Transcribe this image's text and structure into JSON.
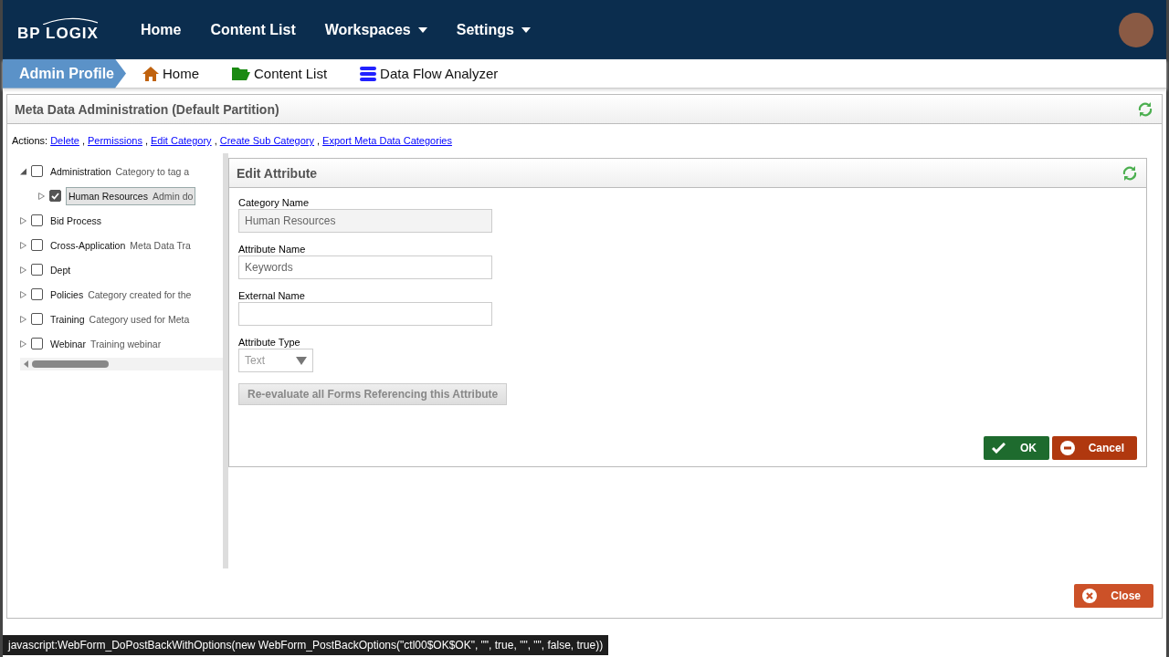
{
  "brand": {
    "logo_text": "BP LOGIX"
  },
  "nav": [
    {
      "label": "Home",
      "dropdown": false
    },
    {
      "label": "Content List",
      "dropdown": false
    },
    {
      "label": "Workspaces",
      "dropdown": true
    },
    {
      "label": "Settings",
      "dropdown": true
    }
  ],
  "breadcrumb": {
    "current": "Admin Profile",
    "links": [
      {
        "kind": "home",
        "label": "Home"
      },
      {
        "kind": "folder",
        "label": "Content List"
      },
      {
        "kind": "database",
        "label": "Data Flow Analyzer"
      }
    ]
  },
  "panel": {
    "title": "Meta Data Administration (Default Partition)",
    "actions_label": "Actions:",
    "actions_separator": ",",
    "actions": [
      "Delete",
      "Permissions",
      "Edit Category",
      "Create Sub Category",
      "Export Meta Data Categories"
    ],
    "tree": [
      {
        "name": "Administration",
        "description": "Category to tag a",
        "checked": false,
        "expanded": true,
        "selected": false,
        "children": [
          {
            "name": "Human Resources",
            "description": "Admin do",
            "checked": true,
            "expanded": false,
            "selected": true
          }
        ]
      },
      {
        "name": "Bid Process",
        "checked": false,
        "expanded": false,
        "selected": false
      },
      {
        "name": "Cross-Application",
        "description": "Meta Data Tra",
        "checked": false,
        "expanded": false,
        "selected": false
      },
      {
        "name": "Dept",
        "checked": false,
        "expanded": false,
        "selected": false
      },
      {
        "name": "Policies",
        "description": "Category created for the",
        "checked": false,
        "expanded": false,
        "selected": false
      },
      {
        "name": "Training",
        "description": "Category used for Meta",
        "checked": false,
        "expanded": false,
        "selected": false
      },
      {
        "name": "Webinar",
        "description": "Training webinar",
        "checked": false,
        "expanded": false,
        "selected": false
      }
    ],
    "edit": {
      "title": "Edit Attribute",
      "fields": [
        {
          "kind": "text",
          "label": "Category Name",
          "value": "Human Resources",
          "disabled": true
        },
        {
          "kind": "text",
          "label": "Attribute Name",
          "value": "Keywords",
          "disabled": false
        },
        {
          "kind": "text",
          "label": "External Name",
          "disabled": false
        },
        {
          "kind": "select",
          "label": "Attribute Type",
          "value": "Text",
          "disabled": true
        }
      ],
      "reevaluate_button": "Re-evaluate all Forms Referencing this Attribute",
      "ok_button": "OK",
      "cancel_button": "Cancel"
    },
    "close_button": "Close"
  },
  "status_bar": "javascript:WebForm_DoPostBackWithOptions(new WebForm_PostBackOptions(\"ctl00$OK$OK\", \"\", true, \"\", \"\", false, true))"
}
